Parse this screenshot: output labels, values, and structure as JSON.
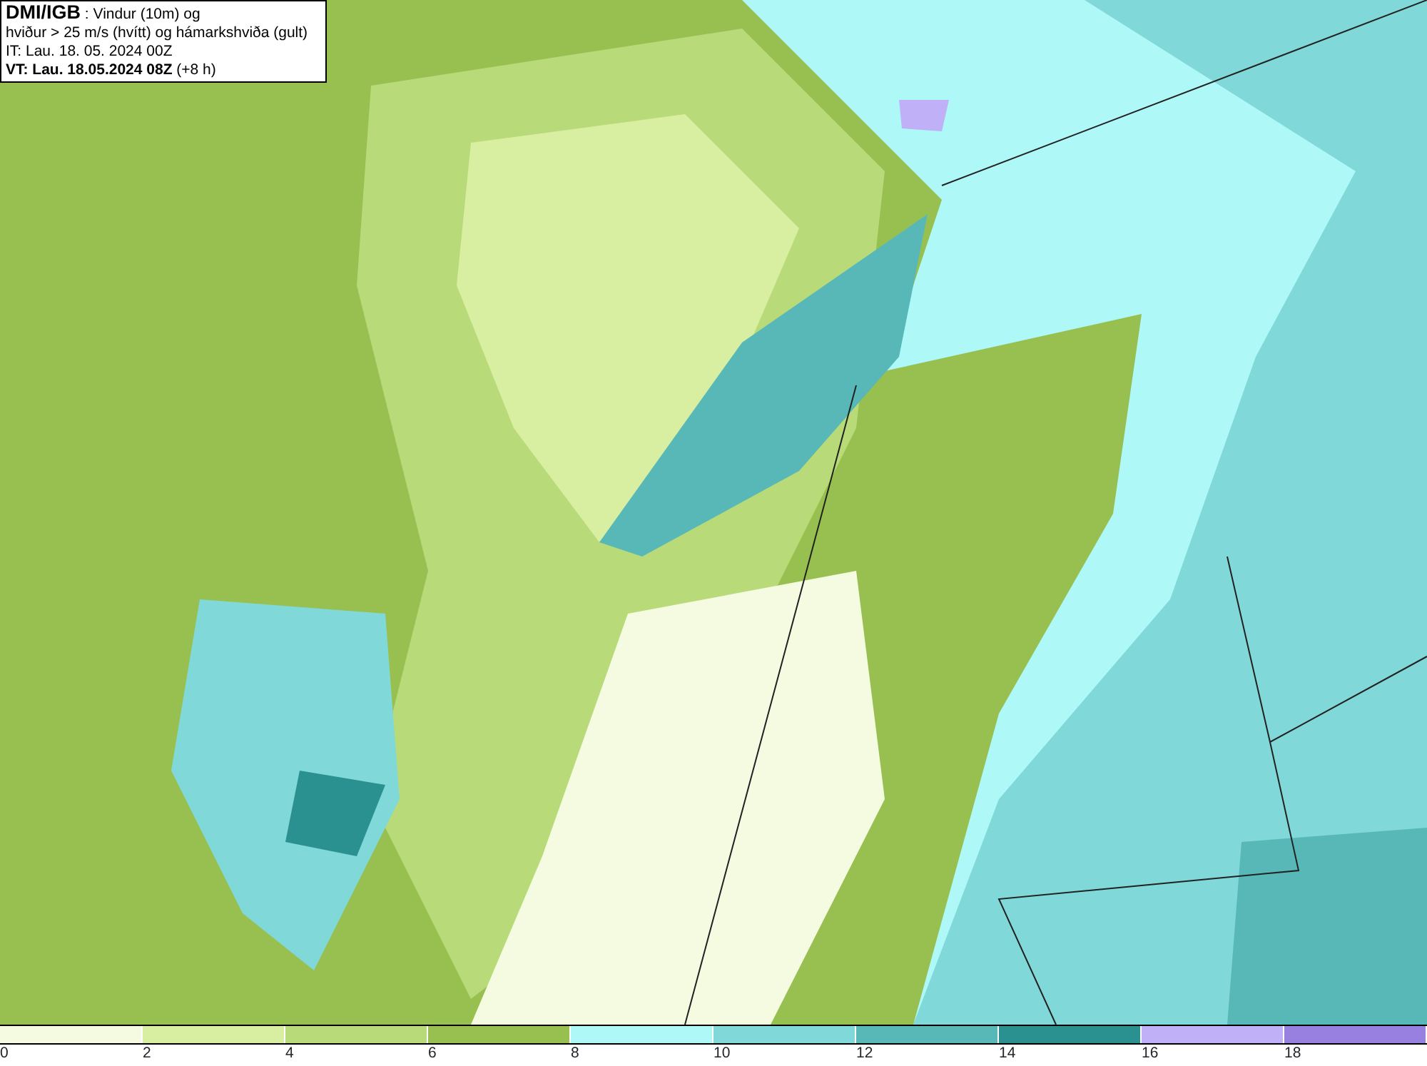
{
  "title_box": {
    "lines": [
      "**DMI/IGB** : Vindur (10m) og",
      "hviður > 25 m/s (hvítt) og hámarkshviða (gult)",
      "IT: Lau. 18. 05. 2024 00Z",
      "**VT: Lau. 18.05.2024 08Z** (+8 h)"
    ]
  },
  "legend": {
    "swatches": [
      {
        "color": "#f4fbe0"
      },
      {
        "color": "#d8eea0"
      },
      {
        "color": "#b8da78"
      },
      {
        "color": "#98c050"
      },
      {
        "color": "#aef8f8"
      },
      {
        "color": "#80d8d8"
      },
      {
        "color": "#58b8b8"
      },
      {
        "color": "#2a9090"
      },
      {
        "color": "#c0b0f8"
      },
      {
        "color": "#9880e0"
      }
    ],
    "ticks": [
      "0",
      "2",
      "4",
      "6",
      "8",
      "10",
      "12",
      "14",
      "16",
      "18"
    ]
  }
}
